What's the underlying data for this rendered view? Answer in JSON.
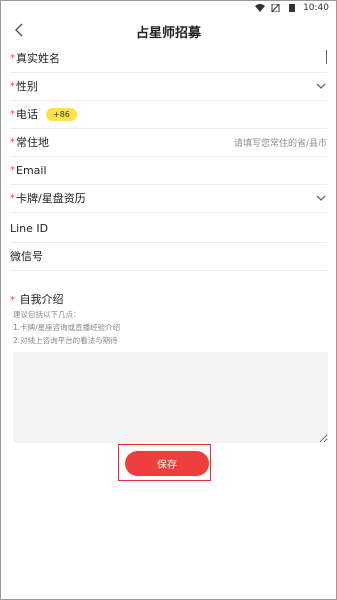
{
  "status_bar": {
    "time": "10:40"
  },
  "header": {
    "title": "占星师招募"
  },
  "form": {
    "name": {
      "required": "*",
      "label": "真实姓名"
    },
    "gender": {
      "required": "*",
      "label": "性别"
    },
    "phone": {
      "required": "*",
      "label": "电话",
      "country_code": "+86"
    },
    "residence": {
      "required": "*",
      "label": "常住地",
      "placeholder": "请填写您常住的省/县市"
    },
    "email": {
      "required": "*",
      "label": "Email"
    },
    "experience": {
      "required": "*",
      "label": "卡牌/星盘资历"
    },
    "line_id": {
      "label": "Line ID"
    },
    "wechat": {
      "label": "微信号"
    },
    "intro": {
      "required": "*",
      "label": "自我介绍",
      "hint_title": "建议包括以下几点：",
      "hint_1": "1.卡牌/星座咨询或直播经验介绍",
      "hint_2": "2.对线上咨询平台的看法与期待"
    }
  },
  "save_button": {
    "label": "保存"
  },
  "colors": {
    "accent": "#ef3e3e",
    "pill": "#ffe24a",
    "required": "#e84a4a"
  }
}
